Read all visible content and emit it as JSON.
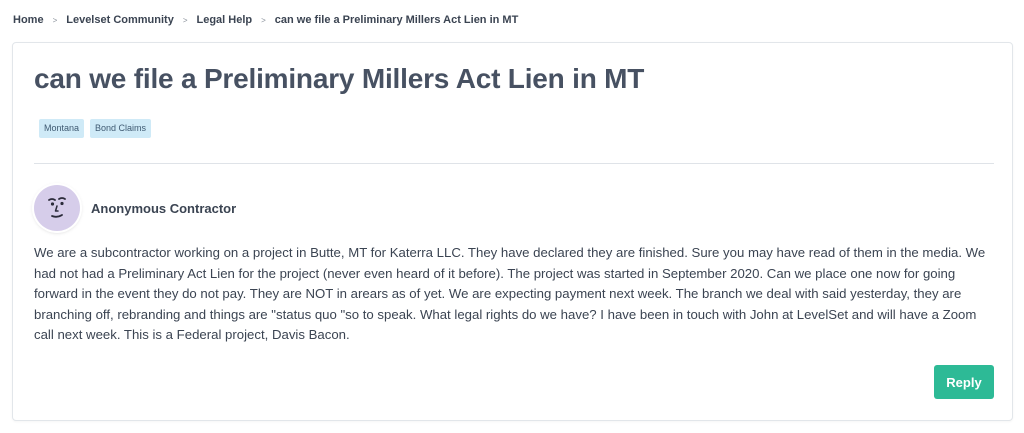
{
  "breadcrumb": {
    "items": [
      "Home",
      "Levelset Community",
      "Legal Help",
      "can we file a Preliminary Millers Act Lien in MT"
    ],
    "separator": ">"
  },
  "post": {
    "title": "can we file a Preliminary Millers Act Lien in MT",
    "tags": [
      "Montana",
      "Bond Claims"
    ],
    "author": {
      "name": "Anonymous Contractor",
      "avatar_icon": "face-avatar-icon"
    },
    "body": "We are a subcontractor working on a project in Butte, MT for Katerra LLC. They have declared they are finished. Sure you may have read of them in the media. We had not had a Preliminary Act Lien for the project (never even heard of it before). The project was started in September 2020. Can we place one now for going forward in the event they do not pay. They are NOT in arears as of yet. We are expecting payment next week. The branch we deal with said yesterday, they are branching off, rebranding and things are \"status quo \"so to speak. What legal rights do we have? I have been in touch with John at LevelSet and will have a Zoom call next week. This is a Federal project, Davis Bacon."
  },
  "actions": {
    "reply_label": "Reply"
  },
  "colors": {
    "accent": "#2dba96",
    "tag_background": "#cfeaf7",
    "avatar_background": "#d6cdea",
    "title_text": "#475162"
  }
}
